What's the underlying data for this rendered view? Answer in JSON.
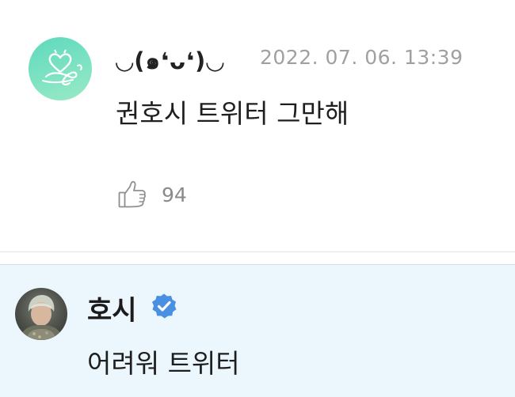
{
  "comment": {
    "author_name": "◡(๑❛ᴗ❛)◡",
    "timestamp": "2022. 07. 06. 13:39",
    "text": "권호시 트위터 그만해",
    "like_icon": "thumbs-up-icon",
    "like_count": "94",
    "avatar_colors": [
      "#5fd8bd",
      "#9be9c6"
    ]
  },
  "reply": {
    "author_name": "호시",
    "verified_icon": "verified-badge-icon",
    "verified_color": "#4a90e2",
    "text": "어려워 트위터",
    "background_color": "#ecf7fd"
  }
}
